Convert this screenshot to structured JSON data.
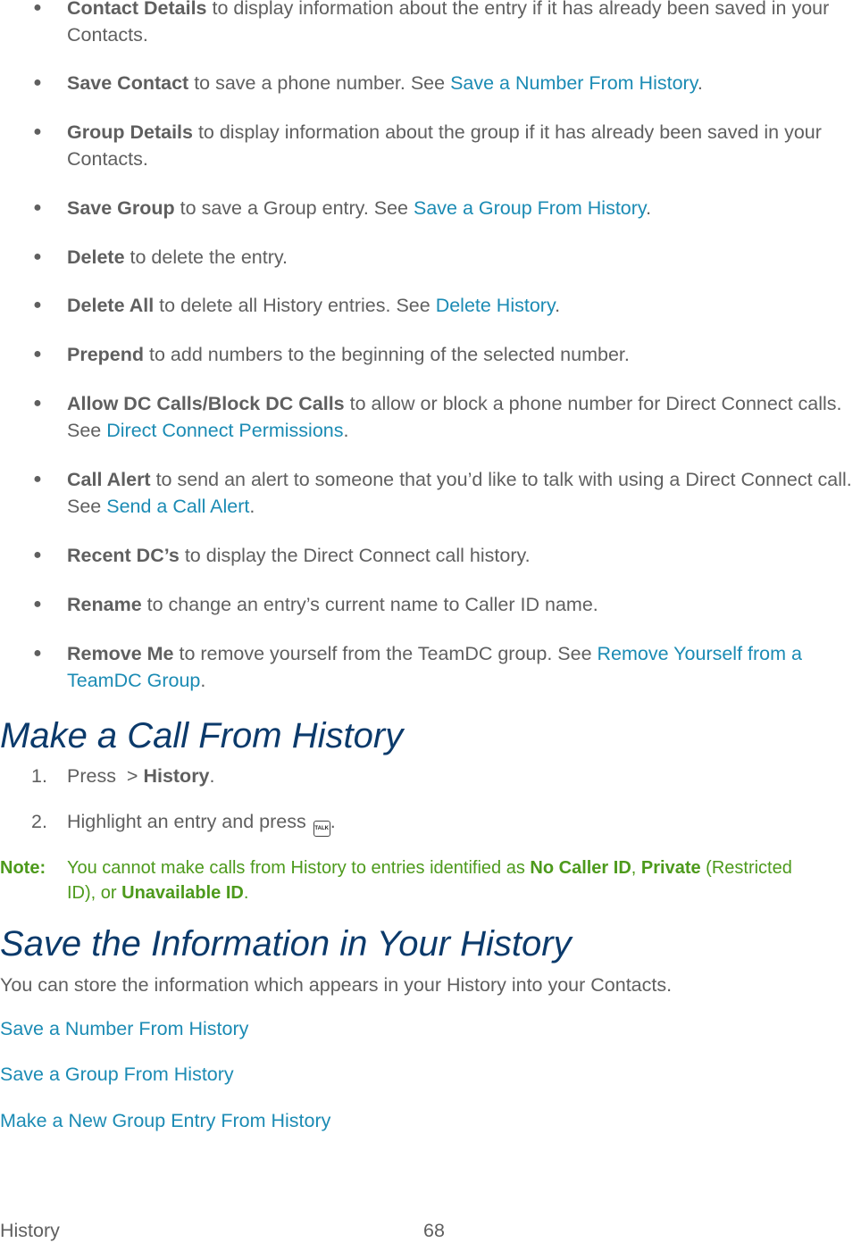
{
  "bullets": [
    {
      "bold": "Contact Details",
      "text": " to display information about the entry if it has already been saved in your Contacts.",
      "link": "",
      "after": ""
    },
    {
      "bold": "Save Contact",
      "text": " to save a phone number. See ",
      "link": "Save a Number From History",
      "after": "."
    },
    {
      "bold": "Group Details",
      "text": " to display information about the group if it has already been saved in your Contacts.",
      "link": "",
      "after": ""
    },
    {
      "bold": "Save Group",
      "text": " to save a Group entry. See ",
      "link": "Save a Group From History",
      "after": "."
    },
    {
      "bold": "Delete",
      "text": " to delete the entry.",
      "link": "",
      "after": ""
    },
    {
      "bold": "Delete All",
      "text": " to delete all History entries. See ",
      "link": "Delete History",
      "after": "."
    },
    {
      "bold": "Prepend",
      "text": " to add numbers to the beginning of the selected number.",
      "link": "",
      "after": ""
    },
    {
      "bold": "Allow DC Calls/Block DC Calls",
      "text": " to allow or block a phone number for Direct Connect calls. See ",
      "link": "Direct Connect Permissions",
      "after": "."
    },
    {
      "bold": "Call Alert",
      "text": " to send an alert to someone that you’d like to talk with using a Direct Connect call. See ",
      "link": "Send a Call Alert",
      "after": "."
    },
    {
      "bold": "Recent DC’s",
      "text": " to display the Direct Connect call history.",
      "link": "",
      "after": ""
    },
    {
      "bold": "Rename",
      "text": " to change an entry’s current name to Caller ID name.",
      "link": "",
      "after": ""
    },
    {
      "bold": "Remove Me",
      "text": " to remove yourself from the TeamDC group. See ",
      "link": "Remove Yourself from a TeamDC Group",
      "after": "."
    }
  ],
  "bullet_glyph": "●",
  "section1": {
    "title": "Make a Call From History",
    "steps": [
      {
        "num": "1.",
        "pre": "Press  > ",
        "bold": "History",
        "post": "."
      },
      {
        "num": "2.",
        "pre": "Highlight an entry and press ",
        "key": "TALK",
        "post": "."
      }
    ],
    "note": {
      "label": "Note:",
      "t1": "You cannot make calls from History to entries identified as ",
      "b1": "No Caller ID",
      "t2": ", ",
      "b2": "Private",
      "t3": " (Restricted ID), or ",
      "b3": "Unavailable ID",
      "t4": "."
    }
  },
  "section2": {
    "title": "Save the Information in Your History",
    "intro": "You can store the information which appears in your History into your Contacts.",
    "links": [
      "Save a Number From History",
      "Save a Group From History",
      "Make a New Group Entry From History"
    ]
  },
  "footer": {
    "section": "History",
    "page": "68"
  },
  "colors": {
    "link": "#1b8bb4",
    "heading": "#0b3a6b",
    "note": "#4d9a1c",
    "body": "#5f5f5f"
  }
}
